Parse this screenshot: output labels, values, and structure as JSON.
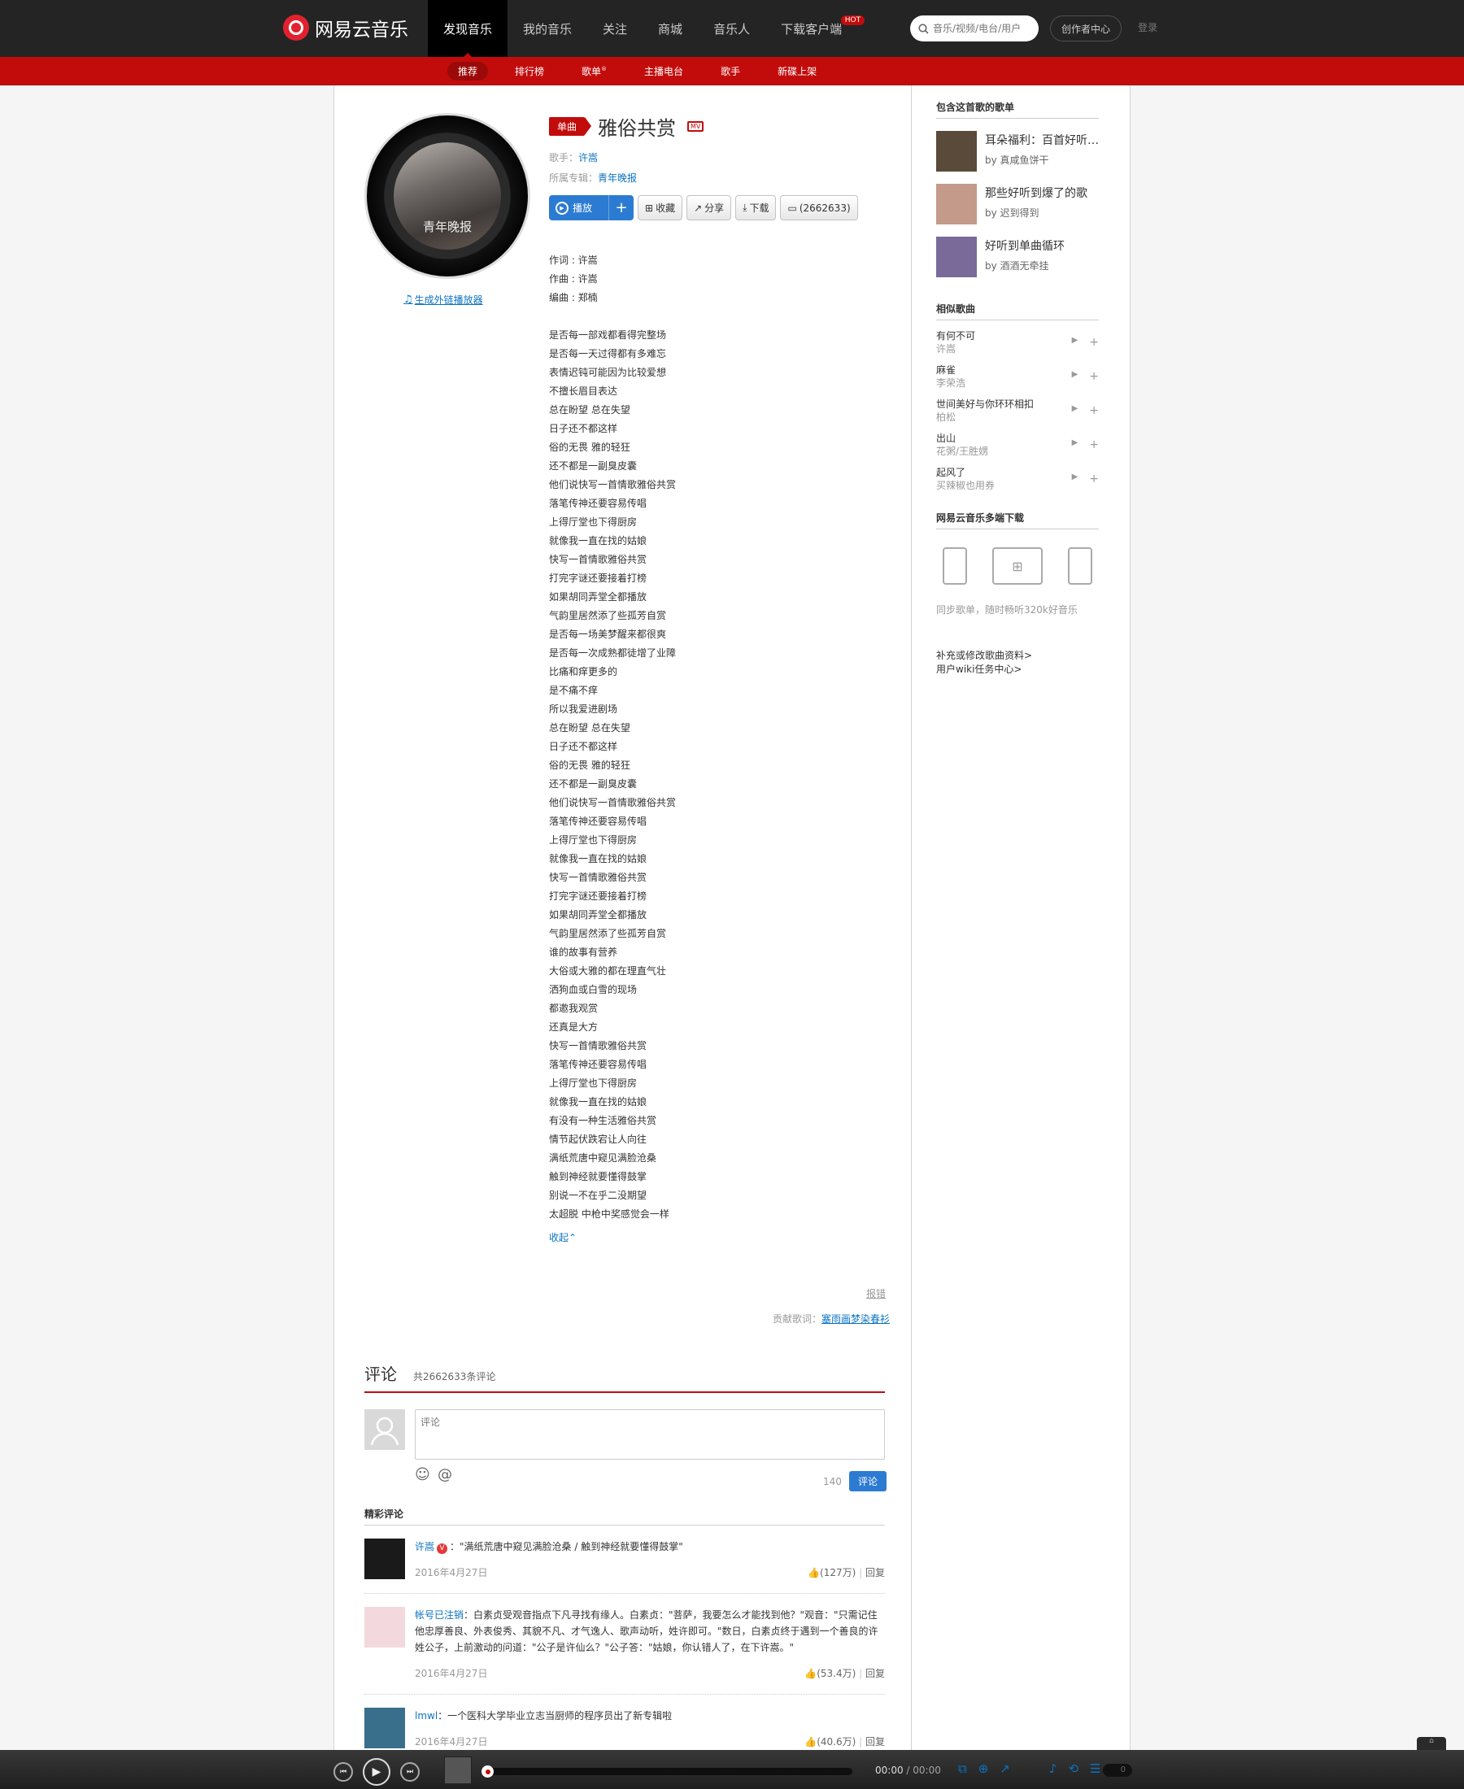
{
  "header": {
    "logo_text": "网易云音乐",
    "nav": [
      {
        "label": "发现音乐",
        "active": true
      },
      {
        "label": "我的音乐"
      },
      {
        "label": "关注"
      },
      {
        "label": "商城"
      },
      {
        "label": "音乐人"
      },
      {
        "label": "下载客户端",
        "badge": "HOT"
      }
    ],
    "search_placeholder": "音乐/视频/电台/用户",
    "creator_label": "创作者中心",
    "login_label": "登录"
  },
  "subnav": [
    {
      "label": "推荐",
      "active": true
    },
    {
      "label": "排行榜"
    },
    {
      "label": "歌单",
      "sup": "®"
    },
    {
      "label": "主播电台"
    },
    {
      "label": "歌手"
    },
    {
      "label": "新碟上架"
    }
  ],
  "song": {
    "tag": "单曲",
    "title": "雅俗共赏",
    "mv_label": "MV",
    "artist_prefix": "歌手：",
    "artist": "许嵩",
    "album_prefix": "所属专辑：",
    "album": "青年晚报",
    "cover_text": "青年晚报",
    "ext_player_label": "生成外链播放器",
    "buttons": {
      "play": "播放",
      "plus": "+",
      "collect": "收藏",
      "share": "分享",
      "download": "下载",
      "comment": "(2662633)"
    }
  },
  "lyrics": {
    "credits": [
      "作词 : 许嵩",
      "作曲 : 许嵩",
      "编曲 : 郑楠"
    ],
    "lines": [
      "是否每一部戏都看得完整场",
      "是否每一天过得都有多难忘",
      "表情迟钝可能因为比较爱想",
      "不擅长眉目表达",
      "总在盼望 总在失望",
      "日子还不都这样",
      "俗的无畏 雅的轻狂",
      "还不都是一副臭皮囊",
      "他们说快写一首情歌雅俗共赏",
      "落笔传神还要容易传唱",
      "上得厅堂也下得厨房",
      "就像我一直在找的姑娘",
      "快写一首情歌雅俗共赏",
      "打完字谜还要接着打榜",
      "如果胡同弄堂全都播放",
      "气韵里居然添了些孤芳自赏",
      "是否每一场美梦醒来都很爽",
      "是否每一次成熟都徒增了业障",
      "比痛和痒更多的",
      "是不痛不痒",
      "所以我爱进剧场",
      "总在盼望 总在失望",
      "日子还不都这样",
      "俗的无畏 雅的轻狂",
      "还不都是一副臭皮囊",
      "他们说快写一首情歌雅俗共赏",
      "落笔传神还要容易传唱",
      "上得厅堂也下得厨房",
      "就像我一直在找的姑娘",
      "快写一首情歌雅俗共赏",
      "打完字谜还要接着打榜",
      "如果胡同弄堂全都播放",
      "气韵里居然添了些孤芳自赏",
      "谁的故事有营养",
      "大俗或大雅的都在理直气壮",
      "洒狗血或白雪的现场",
      "都邀我观赏",
      "还真是大方",
      "快写一首情歌雅俗共赏",
      "落笔传神还要容易传唱",
      "上得厅堂也下得厨房",
      "就像我一直在找的姑娘",
      "有没有一种生活雅俗共赏",
      "情节起伏跌宕让人向往",
      "满纸荒唐中窥见满脸沧桑",
      "触到神经就要懂得鼓掌",
      "别说一不在乎二没期望",
      "太超脱 中枪中奖感觉会一样"
    ],
    "collapse_label": "收起⌃",
    "report_label": "报错",
    "contrib_prefix": "贡献歌词：",
    "contrib_user": "塞雨画梦染春衫"
  },
  "comments": {
    "title": "评论",
    "total": "共2662633条评论",
    "input_placeholder": "评论",
    "char_count": "140",
    "submit_label": "评论",
    "highlight_title": "精彩评论",
    "items": [
      {
        "user": "许嵩",
        "verified": "V",
        "text": "：\"满纸荒唐中窥见满脸沧桑 / 触到神经就要懂得鼓掌\"",
        "date": "2016年4月27日",
        "likes": "(127万)",
        "reply": "回复",
        "avatar_color": "#1a1a1a"
      },
      {
        "user": "帐号已注销",
        "text": "：白素贞受观音指点下凡寻找有缘人。白素贞：\"菩萨，我要怎么才能找到他？\"观音：\"只需记住他忠厚善良、外表俊秀、其貌不凡、才气逸人、歌声动听，姓许即可。\"数日，白素贞终于遇到一个善良的许姓公子，上前激动的问道：\"公子是许仙么？\"公子答：\"姑娘，你认错人了，在下许嵩。\"",
        "date": "2016年4月27日",
        "likes": "(53.4万)",
        "reply": "回复",
        "avatar_color": "#f3d9dd"
      },
      {
        "user": "lmwl",
        "text": "：一个医科大学毕业立志当厨师的程序员出了新专辑啦",
        "date": "2016年4月27日",
        "likes": "(40.6万)",
        "reply": "回复",
        "avatar_color": "#3a6f8c"
      }
    ]
  },
  "sidebar": {
    "playlists_title": "包含这首歌的歌单",
    "playlists": [
      {
        "name": "耳朵福利：百首好听…",
        "by": "by",
        "author": "真咸鱼饼干",
        "color": "#5a4a3a"
      },
      {
        "name": "那些好听到爆了的歌",
        "by": "by",
        "author": "迟到得到",
        "color": "#c49a8a"
      },
      {
        "name": "好听到单曲循环",
        "by": "by",
        "author": "酒酒无牵挂",
        "color": "#7a6a9a"
      }
    ],
    "similar_title": "相似歌曲",
    "similar": [
      {
        "name": "有何不可",
        "artist": "许嵩"
      },
      {
        "name": "麻雀",
        "artist": "李荣浩"
      },
      {
        "name": "世间美好与你环环相扣",
        "artist": "柏松"
      },
      {
        "name": "出山",
        "artist": "花粥/王胜娚"
      },
      {
        "name": "起风了",
        "artist": "买辣椒也用券"
      }
    ],
    "download_title": "网易云音乐多端下载",
    "sync_text": "同步歌单，随时畅听320k好音乐",
    "links": [
      "补充或修改歌曲资料>",
      "用户wiki任务中心>"
    ]
  },
  "player": {
    "time_current": "00:00",
    "time_total": "/ 00:00",
    "playlist_count": "0",
    "progress": 0
  },
  "colors": {
    "brand_red": "#c20c0c",
    "link_blue": "#0c73c2",
    "button_blue": "#2c7bd2"
  }
}
